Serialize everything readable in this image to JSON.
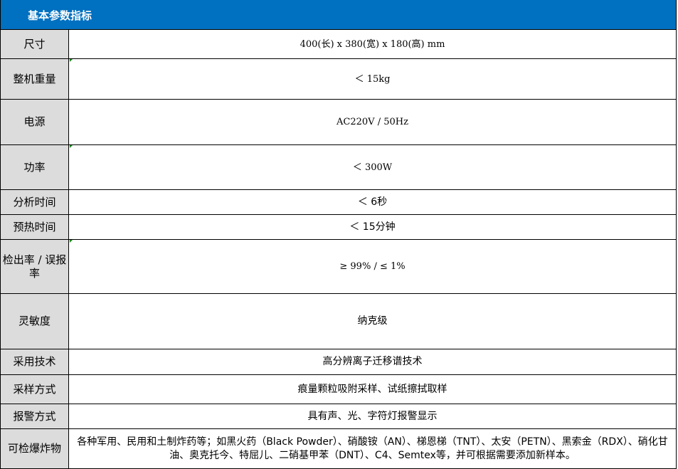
{
  "table": {
    "header": "基本参数指标",
    "rows": [
      {
        "label": "尺寸",
        "value": "400(长) x 380(宽) x 180(高) mm"
      },
      {
        "label": "整机重量",
        "value": "＜ 15kg"
      },
      {
        "label": "电源",
        "value": "AC220V / 50Hz"
      },
      {
        "label": "功率",
        "value": "＜ 300W"
      },
      {
        "label": "分析时间",
        "value": "＜ 6秒"
      },
      {
        "label": "预热时间",
        "value": "＜ 15分钟"
      },
      {
        "label": "检出率 / 误报率",
        "value": "≥ 99% / ≤ 1%"
      },
      {
        "label": "灵敏度",
        "value": "纳克级"
      },
      {
        "label": "采用技术",
        "value": "高分辨离子迁移谱技术"
      },
      {
        "label": "采样方式",
        "value": "痕量颗粒吸附采样、试纸擦拭取样"
      },
      {
        "label": "报警方式",
        "value": "具有声、光、字符灯报警显示"
      },
      {
        "label": "可检爆炸物",
        "value": "各种军用、民用和土制炸药等；如黑火药（Black Powder）、硝酸铵（AN）、梯恩梯（TNT）、太安（PETN）、黑索金（RDX）、硝化甘油、奥克托今、特屈儿、二硝基甲苯（DNT）、C4、Semtex等，并可根据需要添加新样本。"
      }
    ]
  },
  "colors": {
    "header_bg": "#0070c0",
    "label_bg": "#dcdcdc",
    "marker": "#1a8a1a"
  }
}
